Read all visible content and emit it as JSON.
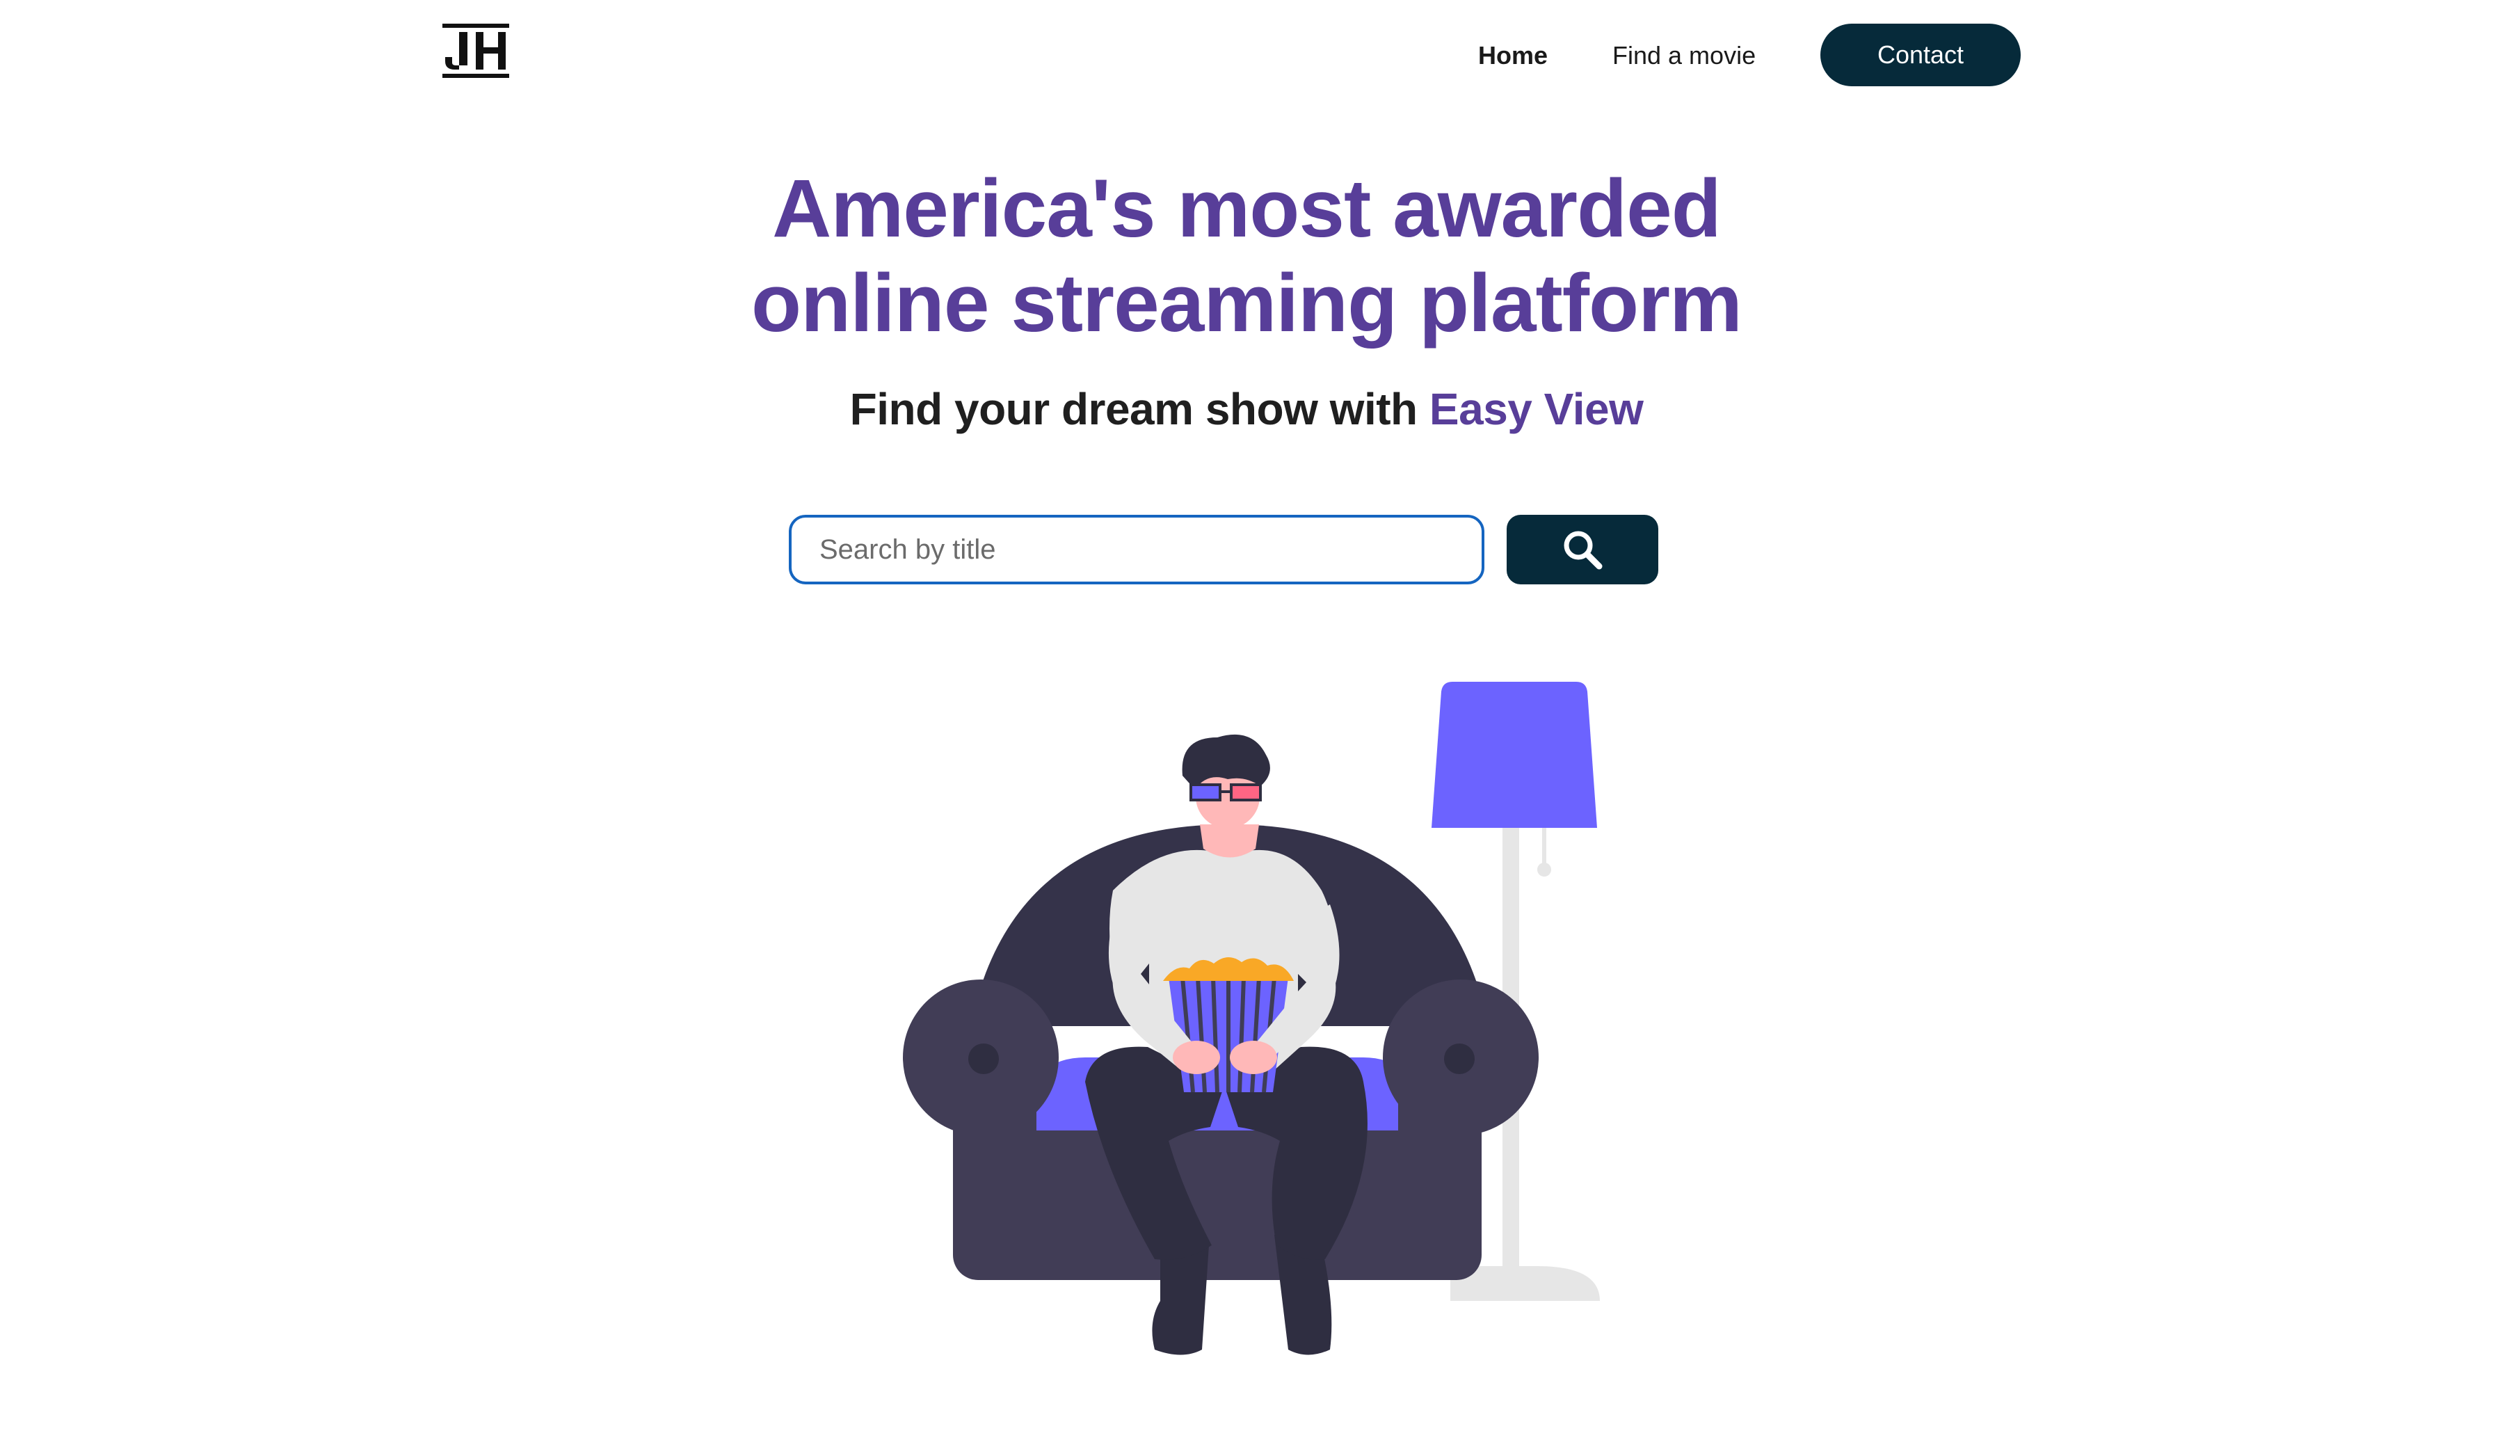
{
  "header": {
    "logo_text": "JH",
    "nav": {
      "home_label": "Home",
      "find_label": "Find a movie"
    },
    "contact_label": "Contact"
  },
  "hero": {
    "title_line1": "America's most awarded",
    "title_line2": "online streaming platform",
    "subtitle_prefix": "Find your dream show with",
    "subtitle_brand": "Easy View"
  },
  "search": {
    "value": "",
    "placeholder": "Search by title",
    "button_icon": "search-icon"
  },
  "illustration": {
    "subject": "person-on-armchair-with-popcorn-and-3d-glasses"
  },
  "colors": {
    "brand_purple": "#583e99",
    "dark_navy": "#062a3a",
    "input_border": "#1565c0",
    "sofa_dark": "#3f3d56",
    "accent_purple": "#6c63ff",
    "popcorn": "#f9a826"
  }
}
